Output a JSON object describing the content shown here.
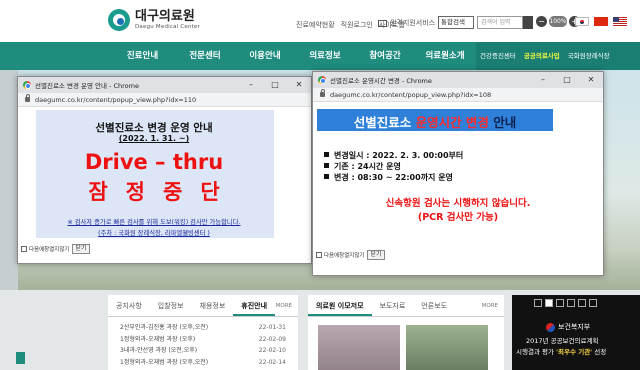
{
  "site": {
    "logo_name": "대구의료원",
    "logo_en": "Daegu Medical Center",
    "util_links": [
      "진료예약현황",
      "직원로그인",
      "사이트맵"
    ],
    "remote_service": "원격지원서비스",
    "search_select": "통합검색",
    "search_placeholder": "검색어 입력",
    "zoom_minus": "−",
    "zoom_value": "100%",
    "zoom_plus": "+"
  },
  "gnb": {
    "items": [
      "진료안내",
      "전문센터",
      "이용안내",
      "의료정보",
      "참여공간",
      "의료원소개"
    ],
    "sub": [
      "건강증진센터",
      "공공의료사업",
      "국화원장례식장"
    ]
  },
  "news_panel": {
    "tabs": [
      "공지사항",
      "입찰정보",
      "채용정보",
      "휴진안내"
    ],
    "active_tab": "휴진안내",
    "more": "MORE",
    "items": [
      {
        "title": "2산부인과-김진홍 과장 (오후,오전)",
        "date": "22-01-31"
      },
      {
        "title": "1정형외과-오재범 과장 (오후)",
        "date": "22-02-09"
      },
      {
        "title": "3내과-안선영 과장 (오전,오후)",
        "date": "22-02-10"
      },
      {
        "title": "1정형외과-오재범 과장 (오후,오전)",
        "date": "22-02-14"
      }
    ]
  },
  "photo_panel": {
    "tabs": [
      "의료원 이모저모",
      "보도자료",
      "언론보도"
    ],
    "more": "MORE"
  },
  "banner": {
    "org": "보건복지부",
    "line1": "2017년 공공보건의료계획",
    "line2_prefix": "시행결과 평가 ",
    "line2_highlight": "'최우수 기관'",
    "line2_suffix": " 선정"
  },
  "popup1": {
    "window_title": "선별진료소 변경 운영 안내 - Chrome",
    "url": "daegumc.co.kr/content/popup_view.php?idx=110",
    "title": "선별진료소 변경 운영 안내",
    "date": "(2022. 1. 31. ~)",
    "headline1": "Drive – thru",
    "headline2": "잠정중단",
    "note1": "※ 검사자 증가로 빠른 검사를 위해 도보(워킹) 검사만 가능합니다.",
    "note2": "(주차 : 국화원 장례식장, 라파엘웰빙센터 )",
    "checkbox_label": "다음에창열지않기",
    "close_label": "닫기"
  },
  "popup2": {
    "window_title": "선별진료소 운영시간 변경 - Chrome",
    "url": "daegumc.co.kr/content/popup_view.php?idx=108",
    "title_part1": "선별진료소 ",
    "title_part2": "운영시간 변경",
    "title_part3": " 안내",
    "lines": [
      "변경일시 : 2022. 2. 3. 00:00부터",
      "기존 : 24시간 운영",
      "변경 : 08:30 ~ 22:00까지 운영"
    ],
    "warning1": "신속항원 검사는 시행하지 않습니다.",
    "warning2": "(PCR 검사만 가능)",
    "checkbox_label": "다음에창열지않기",
    "close_label": "닫기"
  }
}
